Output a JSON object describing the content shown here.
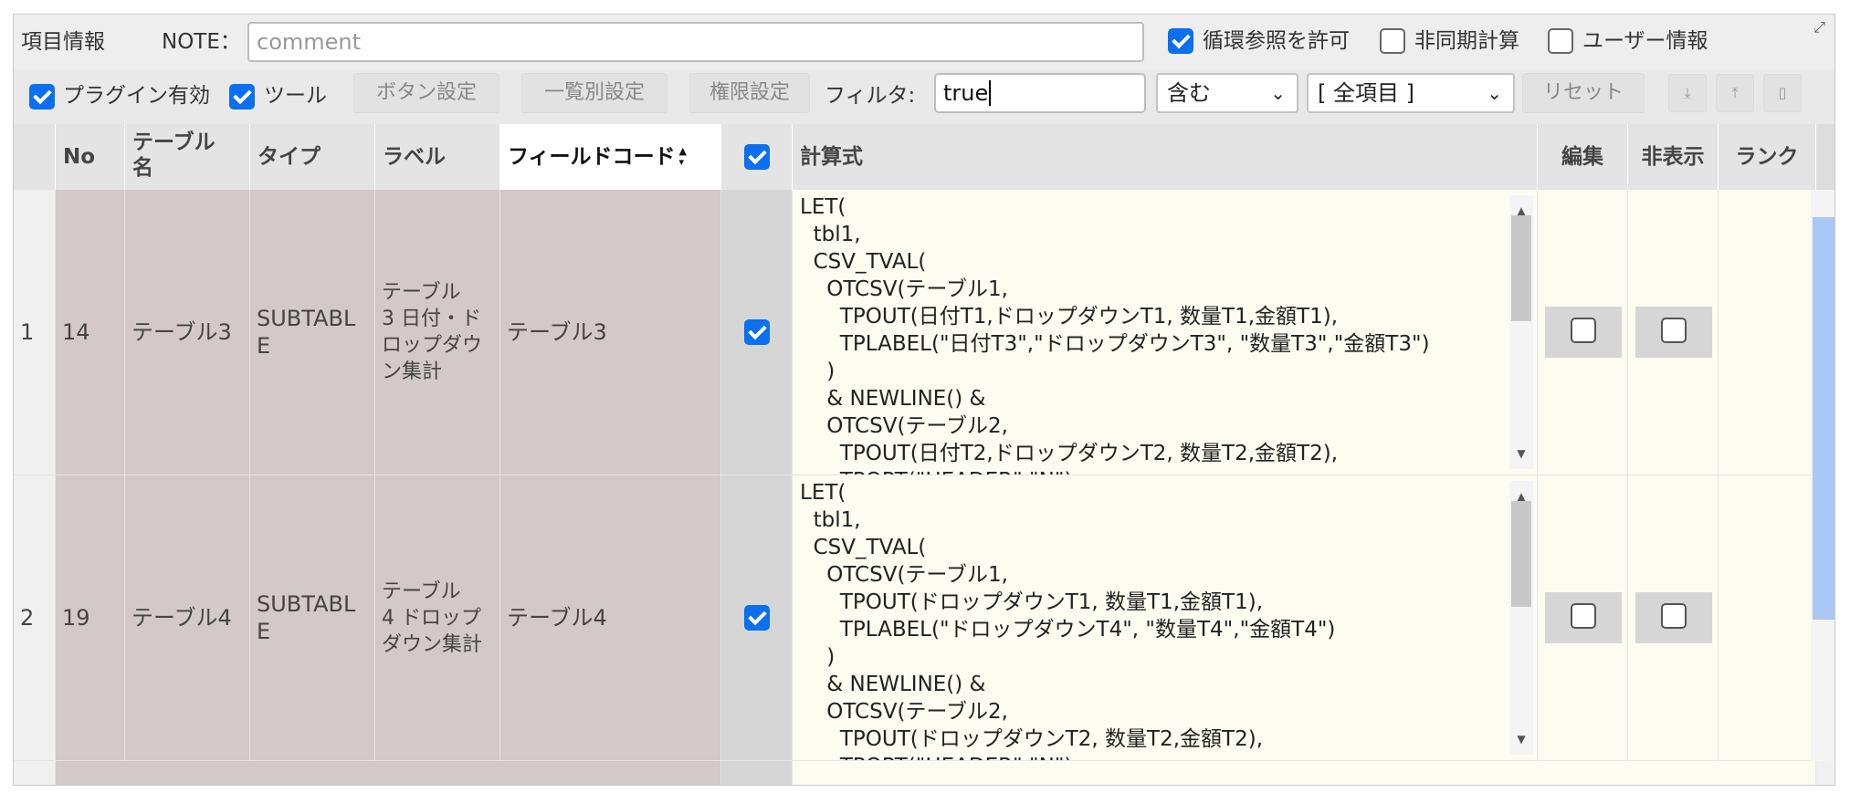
{
  "toolbar1": {
    "title": "項目情報",
    "note_label": "NOTE：",
    "note_placeholder": "comment",
    "opt_circular": "循環参照を許可",
    "opt_async": "非同期計算",
    "opt_user": "ユーザー情報",
    "expand_icon": "expand-icon"
  },
  "toolbar2": {
    "plugin_label": "プラグイン有効",
    "tool_label": "ツール",
    "btn_buttons": "ボタン設定",
    "btn_list": "一覧別設定",
    "btn_perm": "権限設定",
    "filter_label": "フィルタ:",
    "filter_value": "true",
    "match_select": "含む",
    "field_select": "[ 全項目 ]",
    "reset": "リセット"
  },
  "columns": {
    "no": "No",
    "table_name": "テーブル\n名",
    "type": "タイプ",
    "label": "ラベル",
    "field_code": "フィールドコード",
    "formula": "計算式",
    "edit": "編集",
    "hidden": "非表示",
    "rank": "ランク"
  },
  "rows": [
    {
      "index": "1",
      "no": "14",
      "table_name": "テーブル3",
      "type": "SUBTABL\nE",
      "label": "テーブル\n3 日付・ド\nロップダウ\nン集計",
      "field_code": "テーブル3",
      "checked": true,
      "formula": "LET(\n  tbl1,\n  CSV_TVAL(\n    OTCSV(テーブル1,\n      TPOUT(日付T1,ドロップダウンT1, 数量T1,金額T1),\n      TPLABEL(\"日付T3\",\"ドロップダウンT3\", \"数量T3\",\"金額T3\")\n    )\n    & NEWLINE() &\n    OTCSV(テーブル2,\n      TPOUT(日付T2,ドロップダウンT2, 数量T2,金額T2),\n      TPOPT(\"HEADER\",\"N\")"
    },
    {
      "index": "2",
      "no": "19",
      "table_name": "テーブル4",
      "type": "SUBTABL\nE",
      "label": "テーブル\n4 ドロップ\nダウン集計",
      "field_code": "テーブル4",
      "checked": true,
      "formula": "LET(\n  tbl1,\n  CSV_TVAL(\n    OTCSV(テーブル1,\n      TPOUT(ドロップダウンT1, 数量T1,金額T1),\n      TPLABEL(\"ドロップダウンT4\", \"数量T4\",\"金額T4\")\n    )\n    & NEWLINE() &\n    OTCSV(テーブル2,\n      TPOUT(ドロップダウンT2, 数量T2,金額T2),\n      TPOPT(\"HEADER\",\"N\")"
    }
  ]
}
